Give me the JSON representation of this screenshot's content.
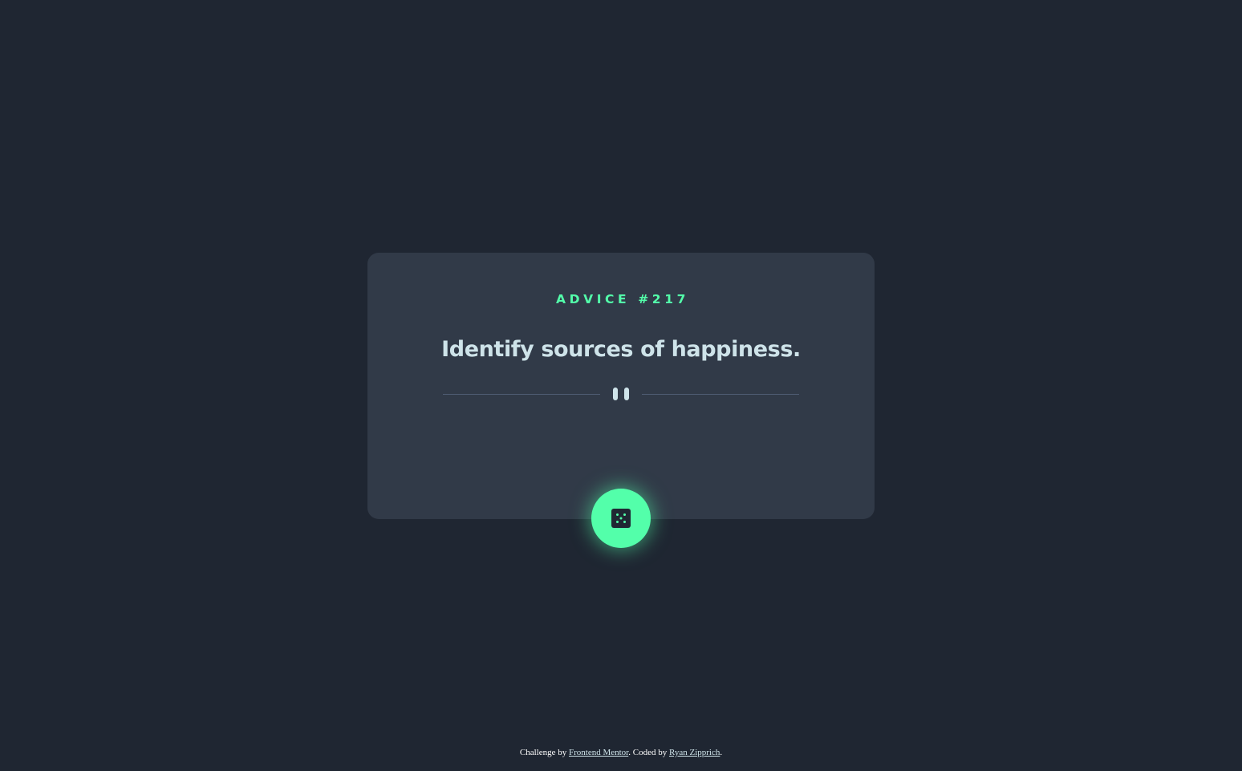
{
  "card": {
    "advice_label": "ADVICE #217",
    "advice_text": "Identify sources of happiness."
  },
  "divider": {
    "icon": "pause-icon"
  },
  "dice_button": {
    "icon": "dice-icon"
  },
  "footer": {
    "prefix": "Challenge by ",
    "challenge_link": "Frontend Mentor",
    "middle": ". Coded by ",
    "author_link": "Ryan Zipprich",
    "suffix": "."
  },
  "colors": {
    "page_background": "#1f2632",
    "card_background": "#313a48",
    "accent": "#53ffaa",
    "text_light": "#cee3e9",
    "divider": "#4f5d74"
  }
}
